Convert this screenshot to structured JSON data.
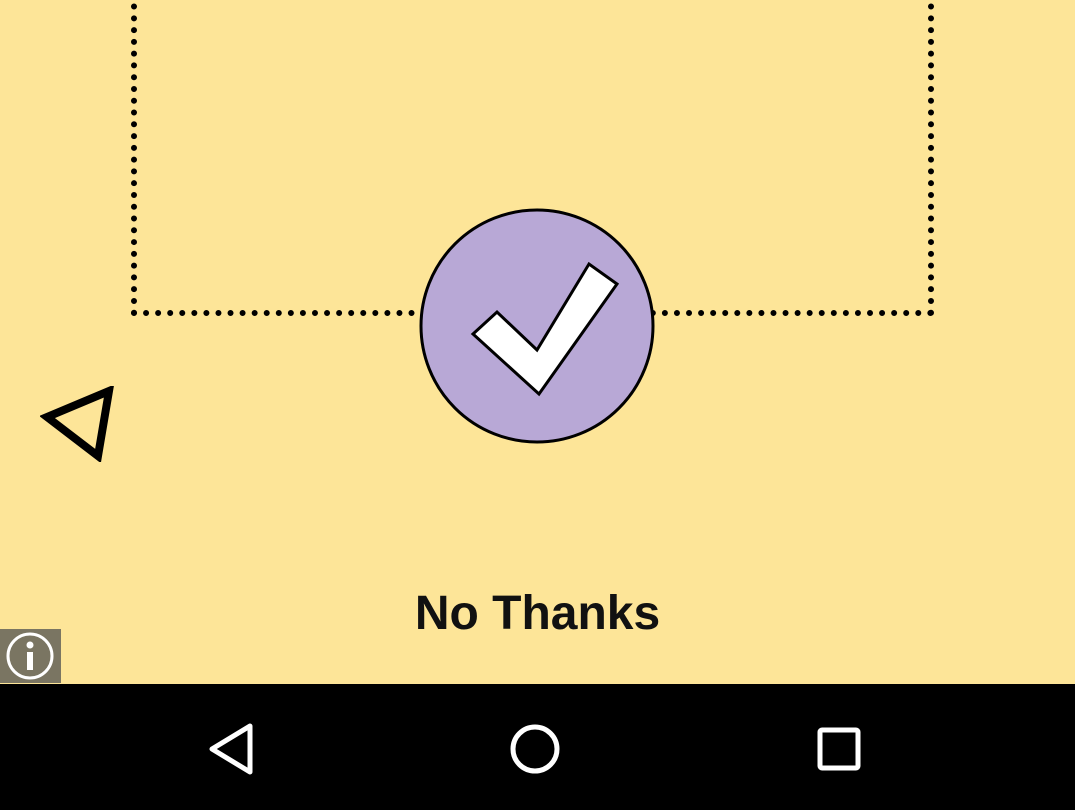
{
  "screen": {
    "background_color": "#fde598",
    "accent_color": "#b8a8d6",
    "nav_bar_color": "#000000"
  },
  "confirm": {
    "icon": "checkmark-icon"
  },
  "indicator": {
    "icon": "triangle-pointer-icon"
  },
  "dismiss": {
    "label": "No Thanks"
  },
  "info": {
    "icon": "info-icon"
  },
  "nav": {
    "back_icon": "back-triangle-icon",
    "home_icon": "home-circle-icon",
    "recents_icon": "recents-square-icon"
  }
}
